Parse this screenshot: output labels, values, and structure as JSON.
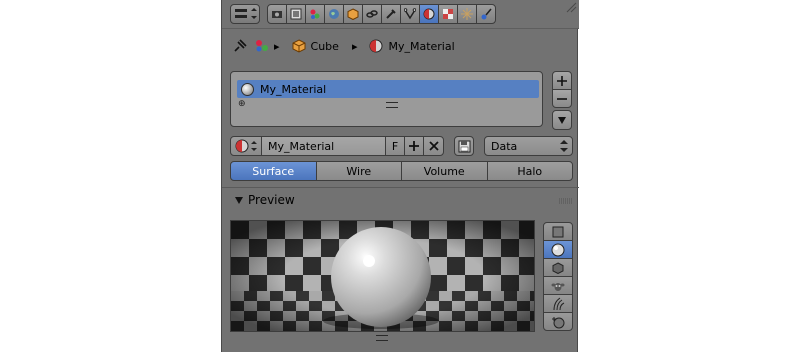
{
  "breadcrumb": {
    "object": "Cube",
    "material": "My_Material"
  },
  "material_slots": [
    {
      "name": "My_Material",
      "selected": true
    }
  ],
  "datablock": {
    "name": "My_Material",
    "fake_user_label": "F",
    "link_option": "Data"
  },
  "tabs": [
    {
      "label": "Surface",
      "active": true
    },
    {
      "label": "Wire",
      "active": false
    },
    {
      "label": "Volume",
      "active": false
    },
    {
      "label": "Halo",
      "active": false
    }
  ],
  "preview": {
    "title": "Preview",
    "shapes": [
      "flat-plane-icon",
      "sphere-icon",
      "cube-icon",
      "monkey-icon",
      "hair-icon",
      "sphere-sky-icon"
    ],
    "active_shape": "sphere-icon"
  },
  "context_tabs": [
    "render-icon",
    "render-layers-icon",
    "scene-icon",
    "world-icon",
    "object-icon",
    "constraints-icon",
    "modifiers-icon",
    "data-icon",
    "material-icon",
    "texture-icon",
    "particles-icon",
    "physics-icon"
  ],
  "active_context": "material-icon",
  "colors": {
    "panel_bg": "#727272",
    "accent_blue": "#5680c2"
  }
}
